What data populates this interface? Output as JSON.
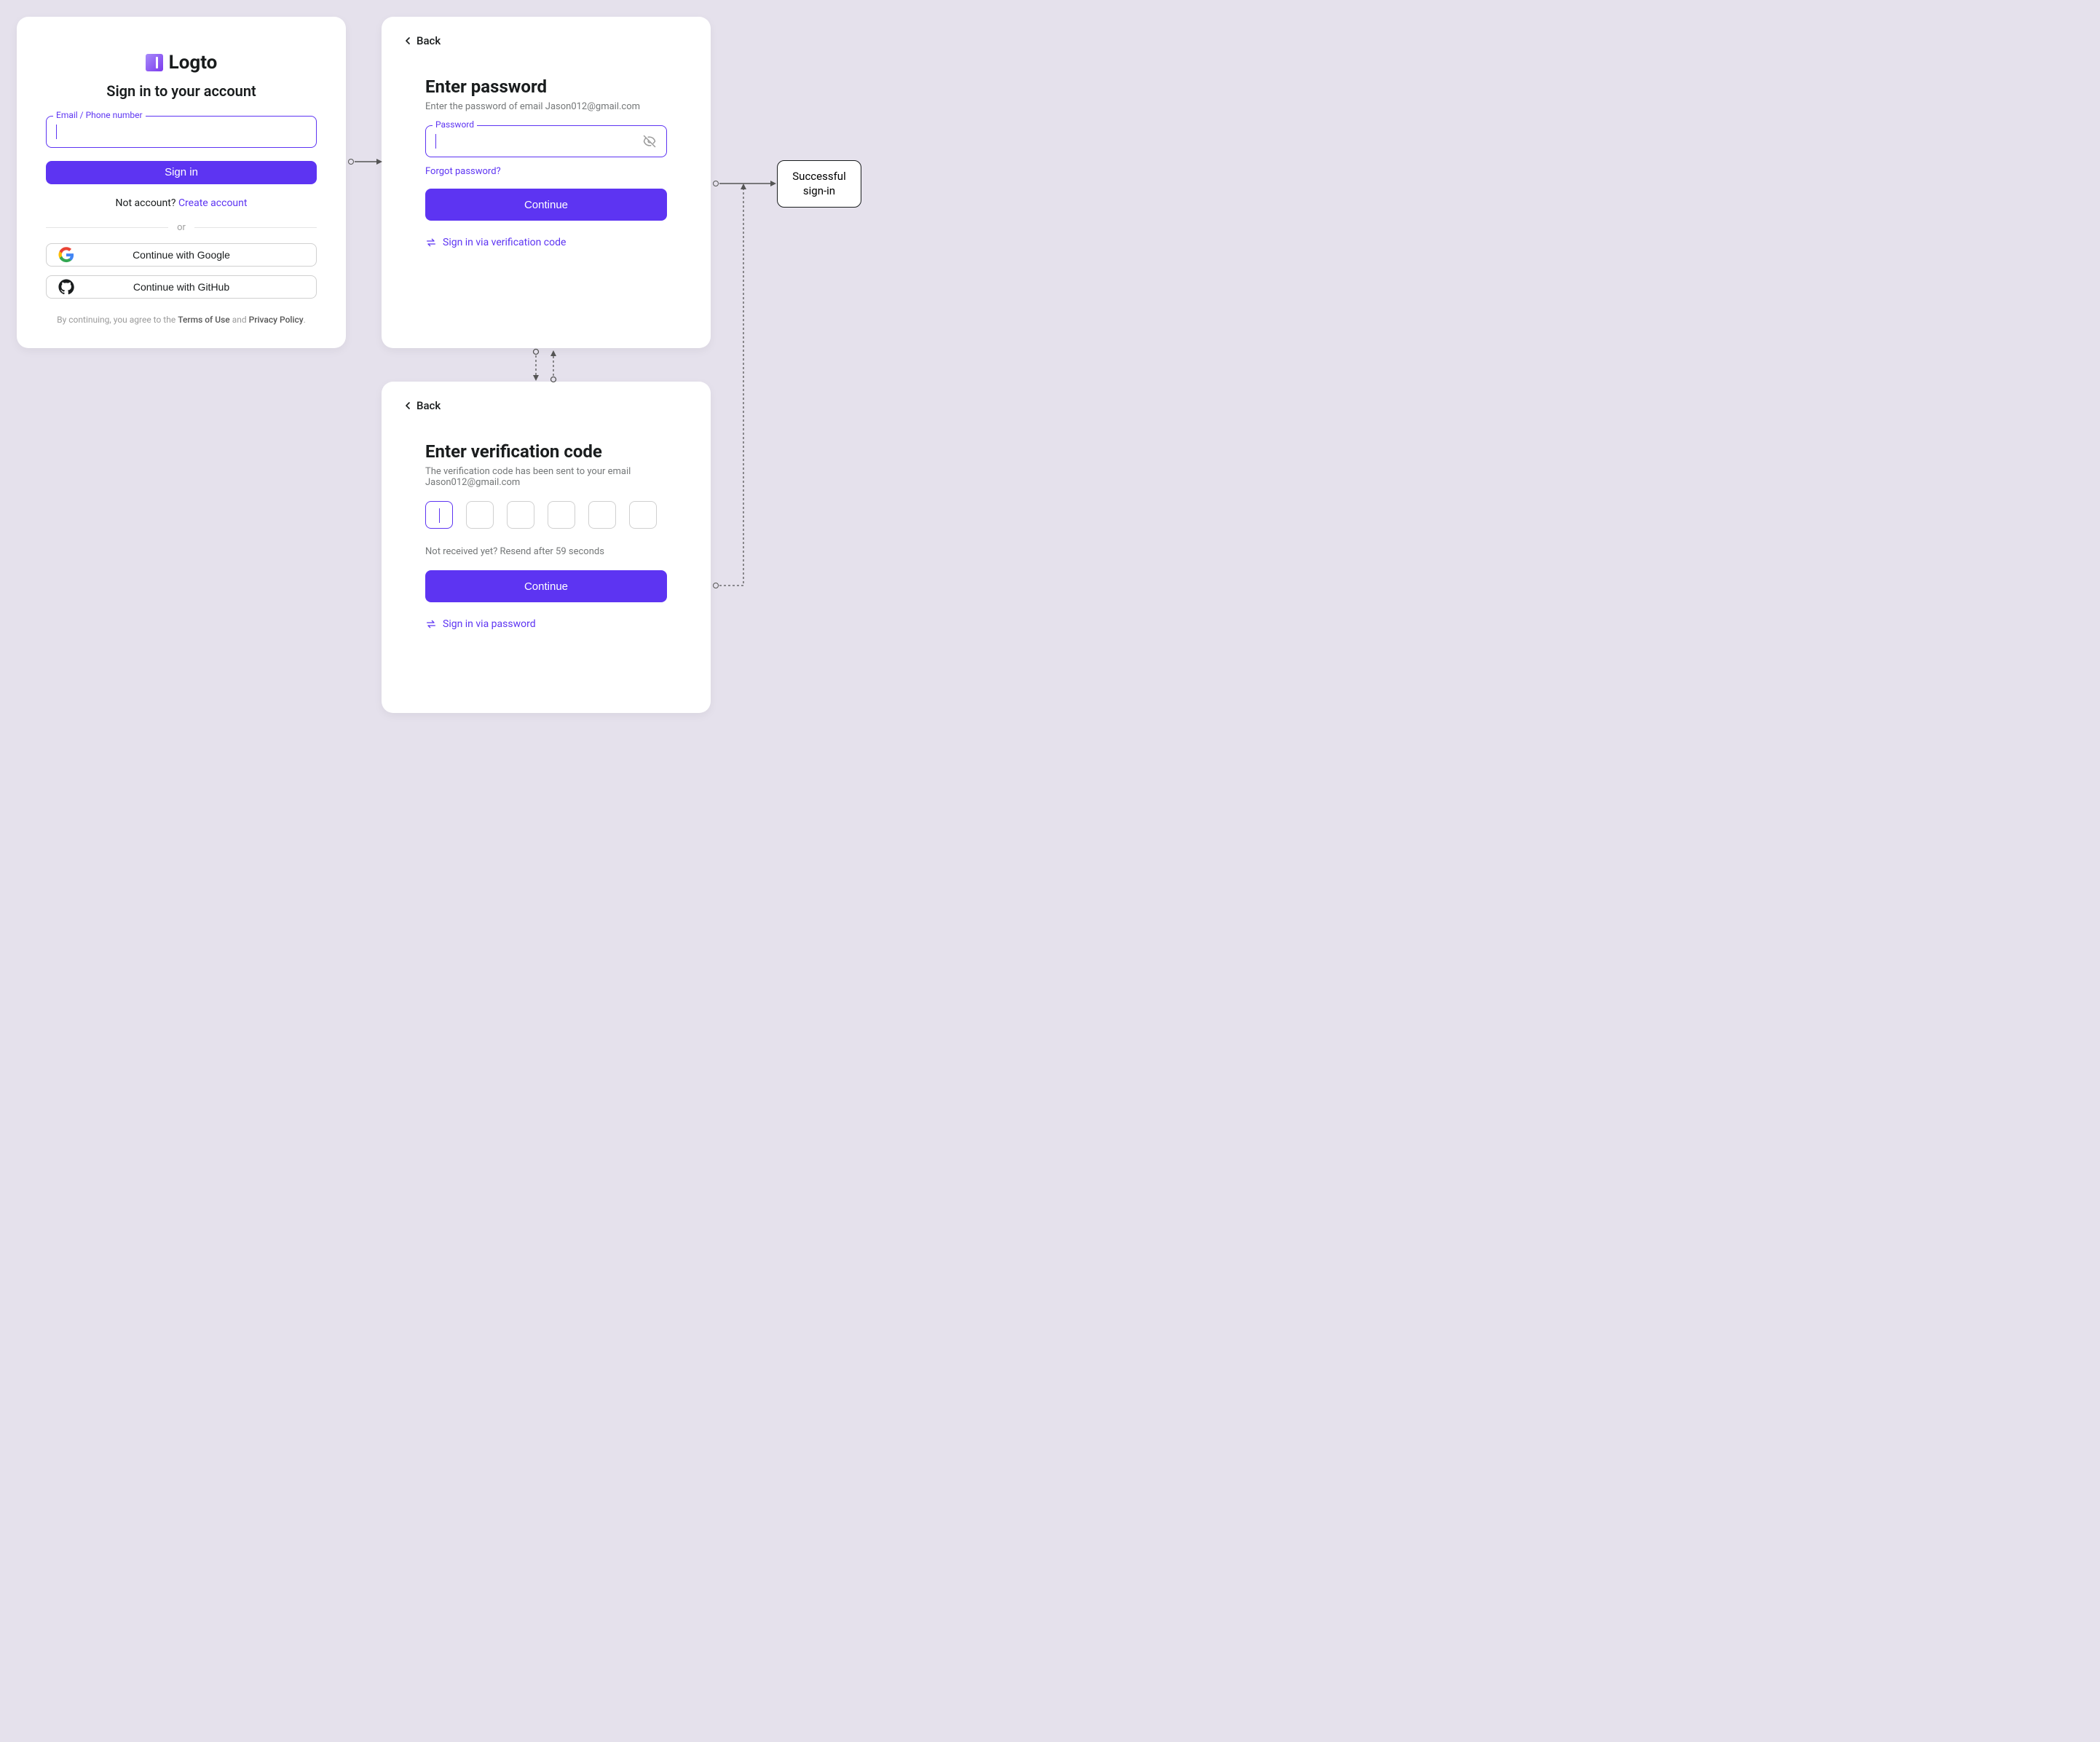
{
  "signin": {
    "brand": "Logto",
    "title": "Sign in to your account",
    "input_label": "Email / Phone number",
    "submit": "Sign in",
    "noacct_prefix": "Not account? ",
    "create": "Create account",
    "divider": "or",
    "google": "Continue with Google",
    "github": "Continue with GitHub",
    "terms_prefix": "By continuing, you agree to the ",
    "terms_of_use": "Terms of Use",
    "terms_mid": " and ",
    "privacy": "Privacy Policy",
    "terms_suffix": "."
  },
  "password": {
    "back": "Back",
    "title": "Enter password",
    "sub_prefix": "Enter the password of email ",
    "email": "Jason012@gmail.com",
    "input_label": "Password",
    "forgot": "Forgot password?",
    "continue": "Continue",
    "alt": "Sign in via verification code"
  },
  "code": {
    "back": "Back",
    "title": "Enter verification code",
    "sub_prefix": "The verification code has been sent to your email ",
    "email": "Jason012@gmail.com",
    "digits": 6,
    "resend": "Not received yet? Resend after 59 seconds",
    "continue": "Continue",
    "alt": "Sign in via password"
  },
  "success": {
    "line1": "Successful",
    "line2": "sign-in"
  }
}
